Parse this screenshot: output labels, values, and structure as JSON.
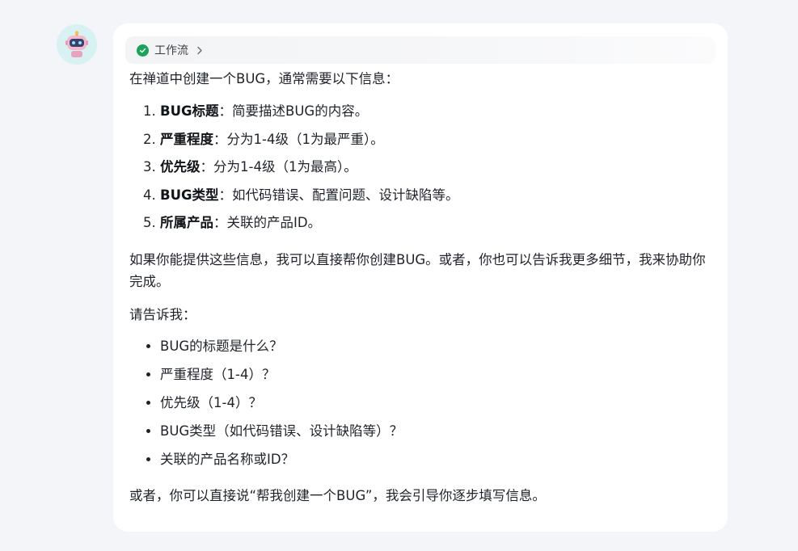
{
  "workflow": {
    "label": "工作流"
  },
  "message": {
    "intro": "在禅道中创建一个BUG，通常需要以下信息：",
    "fields": [
      {
        "term": "BUG标题",
        "desc": "：简要描述BUG的内容。"
      },
      {
        "term": "严重程度",
        "desc": "：分为1-4级（1为最严重）。"
      },
      {
        "term": "优先级",
        "desc": "：分为1-4级（1为最高）。"
      },
      {
        "term": "BUG类型",
        "desc": "：如代码错误、配置问题、设计缺陷等。"
      },
      {
        "term": "所属产品",
        "desc": "：关联的产品ID。"
      }
    ],
    "offer": "如果你能提供这些信息，我可以直接帮你创建BUG。或者，你也可以告诉我更多细节，我来协助你完成。",
    "ask": "请告诉我：",
    "questions": [
      "BUG的标题是什么？",
      "严重程度（1-4）？",
      "优先级（1-4）？",
      "BUG类型（如代码错误、设计缺陷等）？",
      "关联的产品名称或ID？"
    ],
    "closing": "或者，你可以直接说“帮我创建一个BUG”，我会引导你逐步填写信息。"
  },
  "colors": {
    "background": "#f4f5f8",
    "bubble": "#ffffff",
    "success": "#1aa35a",
    "avatar_bg": "#d8f1f2"
  }
}
